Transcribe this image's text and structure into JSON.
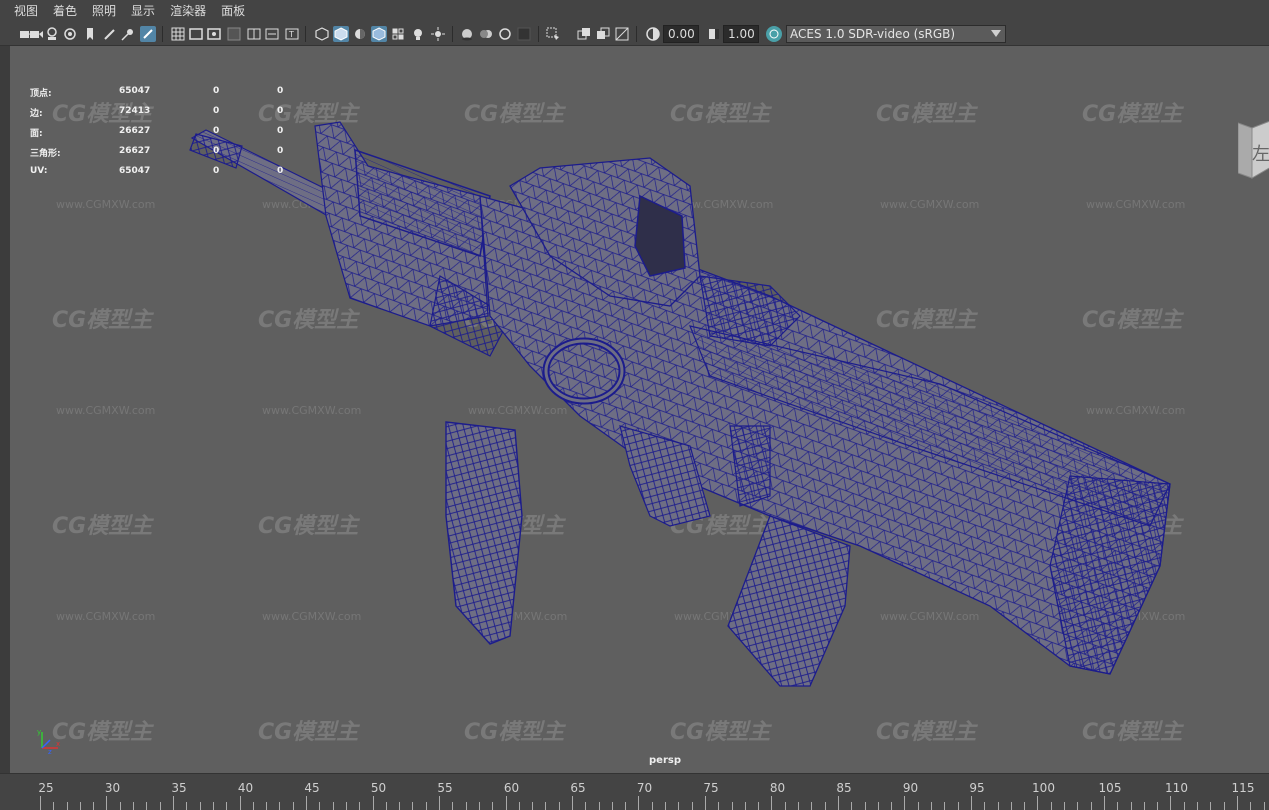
{
  "menu": [
    "视图",
    "着色",
    "照明",
    "显示",
    "渲染器",
    "面板"
  ],
  "toolbar": {
    "exposure_value": "0.00",
    "gamma_value": "1.00",
    "color_space": "ACES 1.0 SDR-video (sRGB)"
  },
  "hud": {
    "rows": [
      {
        "label": "顶点:",
        "value": "65047",
        "c1": "0",
        "c2": "0"
      },
      {
        "label": "边:",
        "value": "72413",
        "c1": "0",
        "c2": "0"
      },
      {
        "label": "面:",
        "value": "26627",
        "c1": "0",
        "c2": "0"
      },
      {
        "label": "三角形:",
        "value": "26627",
        "c1": "0",
        "c2": "0"
      },
      {
        "label": "UV:",
        "value": "65047",
        "c1": "0",
        "c2": "0"
      }
    ]
  },
  "viewcube_label": "左",
  "camera_label": "persp",
  "watermark": {
    "logo": "CG模型主",
    "url": "www.CGMXW.com"
  },
  "axis_labels": {
    "x": "x",
    "y": "y",
    "z": "z"
  },
  "timeline": {
    "ticks": [
      "25",
      "30",
      "35",
      "40",
      "45",
      "50",
      "55",
      "60",
      "65",
      "70",
      "75",
      "80",
      "85",
      "90",
      "95",
      "100",
      "105",
      "110",
      "115"
    ]
  },
  "colors": {
    "viewport_bg": "#5f5f5f",
    "wireframe": "#1c1c8c",
    "mesh_fill": "#6e6e84",
    "active_icon": "#5285a6"
  }
}
